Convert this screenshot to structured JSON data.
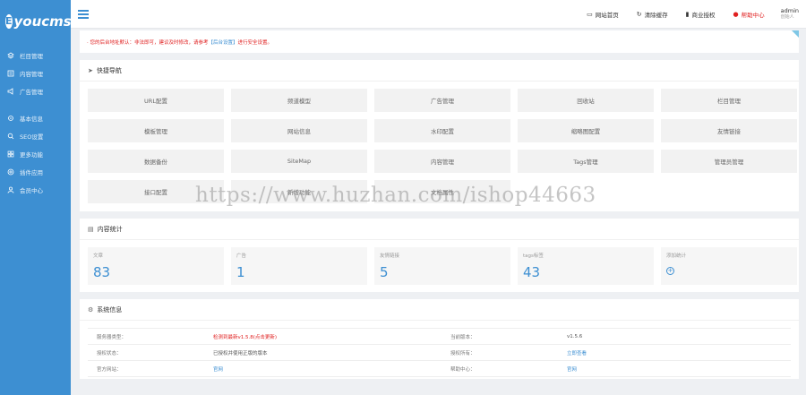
{
  "app": {
    "logo": "Eyoucms",
    "logo_mark": "E"
  },
  "sidebar": {
    "group1": [
      {
        "label": "栏目管理",
        "icon": "stack-icon"
      },
      {
        "label": "内容管理",
        "icon": "list-icon"
      },
      {
        "label": "广告管理",
        "icon": "megaphone-icon"
      }
    ],
    "group2": [
      {
        "label": "基本信息",
        "icon": "settings-icon"
      },
      {
        "label": "SEO设置",
        "icon": "seo-icon"
      },
      {
        "label": "更多功能",
        "icon": "apps-icon"
      },
      {
        "label": "插件应用",
        "icon": "plugin-icon"
      },
      {
        "label": "会员中心",
        "icon": "user-icon"
      }
    ]
  },
  "topbar": {
    "home": "网站首页",
    "clear_cache": "清除缓存",
    "auth": "商业授权",
    "help": "帮助中心",
    "user_name": "admin",
    "user_role": "创始人"
  },
  "notice": {
    "text_before": "· 您的后台地址默认：非法即可，建议及时修改，请参考",
    "link": "【后台设置】",
    "text_after": "进行安全设置。"
  },
  "quick_nav": {
    "title": "快捷导航",
    "items": [
      "URL配置",
      "频道模型",
      "广告管理",
      "回收站",
      "栏目管理",
      "模板管理",
      "网站信息",
      "水印配置",
      "缩略图配置",
      "友情链接",
      "数据备份",
      "SiteMap",
      "内容管理",
      "Tags管理",
      "管理员管理",
      "接口配置",
      "新增功能",
      "文档属性"
    ]
  },
  "stats": {
    "title": "内容统计",
    "items": [
      {
        "label": "文章",
        "value": "83"
      },
      {
        "label": "广告",
        "value": "1"
      },
      {
        "label": "友情链接",
        "value": "5"
      },
      {
        "label": "tags标签",
        "value": "43"
      },
      {
        "label": "添加统计",
        "value": ""
      }
    ]
  },
  "sysinfo": {
    "title": "系统信息",
    "rows": [
      {
        "k1": "服务器类型：",
        "v1": "检测到最新v1.5.8(点击更新)",
        "k2": "当前版本：",
        "v2": "v1.5.6"
      },
      {
        "k1": "授权状态：",
        "v1": "已授权并使用正版的版本",
        "k2": "授权所有：",
        "v2": "立即查看"
      },
      {
        "k1": "官方网站：",
        "v1": "官网",
        "k2": "帮助中心：",
        "v2": "官网"
      }
    ]
  },
  "watermark": "https://www.huzhan.com/ishop44663",
  "colors": {
    "sidebar": "#3d8fd2",
    "accent": "#3d8fd2",
    "danger": "#e02020"
  }
}
